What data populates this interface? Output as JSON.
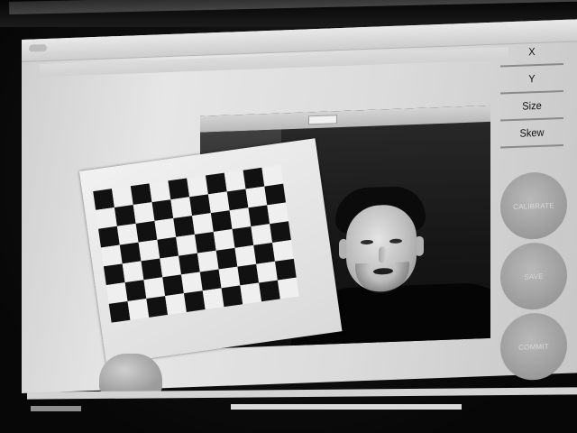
{
  "params": {
    "x_label": "X",
    "y_label": "Y",
    "size_label": "Size",
    "skew_label": "Skew"
  },
  "buttons": {
    "calibrate_label": "CALIBRATE",
    "save_label": "SAVE",
    "commit_label": "COMMIT"
  },
  "icons": {
    "checkerboard": "checkerboard-pattern"
  },
  "colors": {
    "board_dark": "#111111",
    "board_light": "#efefef"
  }
}
